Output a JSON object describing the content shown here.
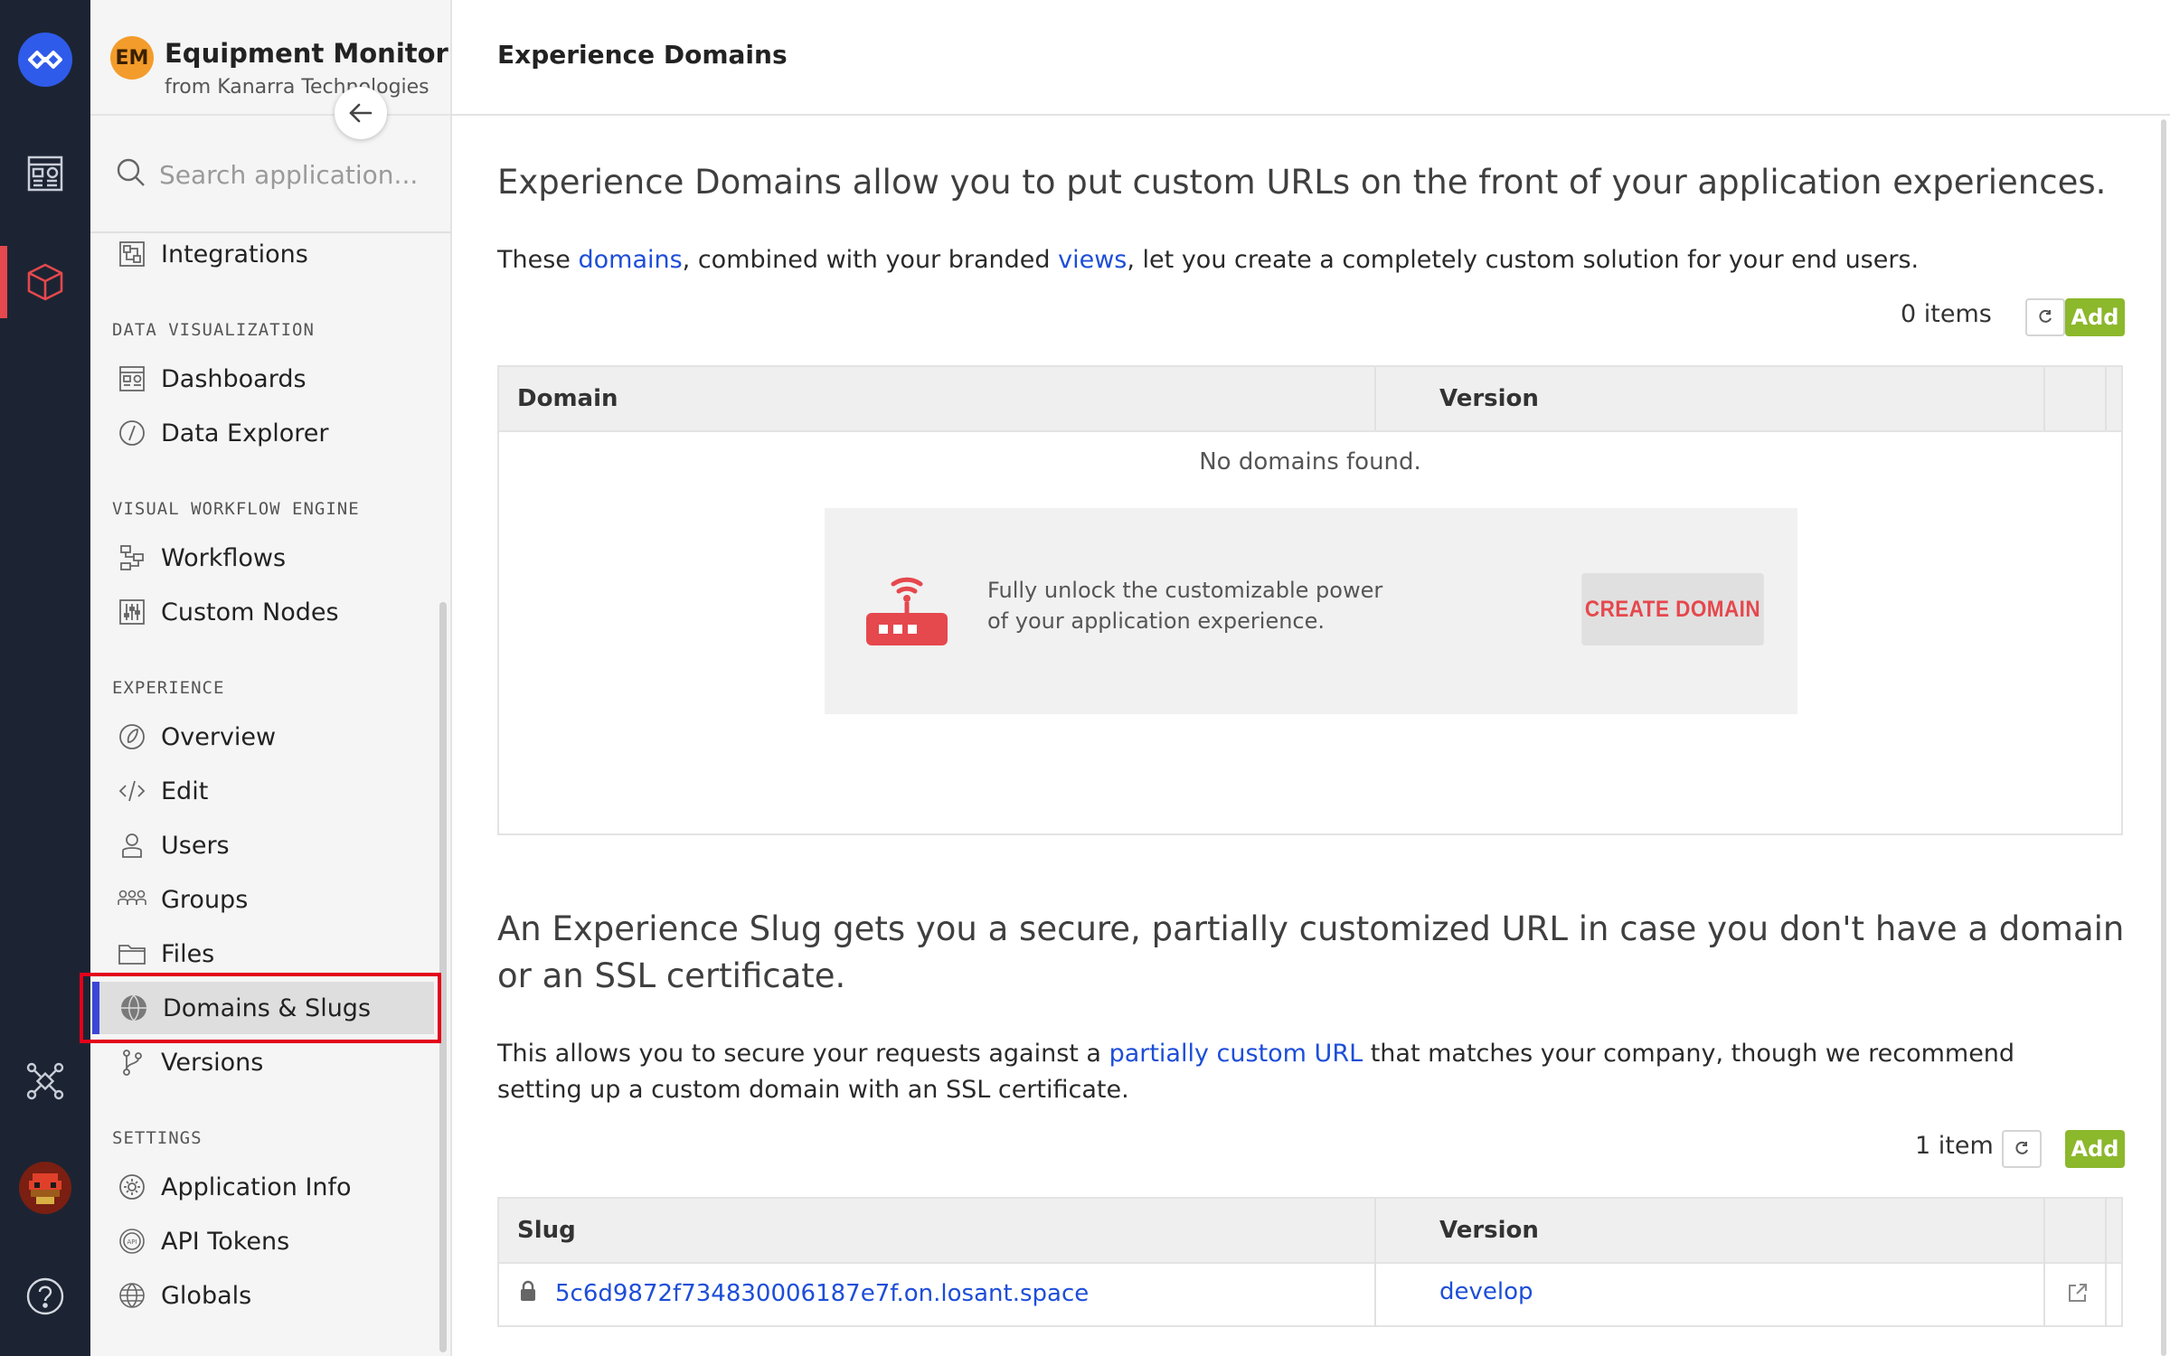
{
  "app": {
    "initials": "EM",
    "name": "Equipment Monitor",
    "org": "from Kanarra Technologies"
  },
  "search": {
    "placeholder": "Search application..."
  },
  "sidebar": {
    "integrations": "Integrations",
    "sections": {
      "data_viz": "DATA VISUALIZATION",
      "workflow": "VISUAL WORKFLOW ENGINE",
      "experience": "EXPERIENCE",
      "settings": "SETTINGS"
    },
    "items": {
      "dashboards": "Dashboards",
      "data_explorer": "Data Explorer",
      "workflows": "Workflows",
      "custom_nodes": "Custom Nodes",
      "overview": "Overview",
      "edit": "Edit",
      "users": "Users",
      "groups": "Groups",
      "files": "Files",
      "domains_slugs": "Domains & Slugs",
      "versions": "Versions",
      "application_info": "Application Info",
      "api_tokens": "API Tokens",
      "globals": "Globals"
    },
    "active_item": "Domains & Slugs"
  },
  "page": {
    "title": "Experience Domains"
  },
  "domains": {
    "lead": "Experience Domains allow you to put custom URLs on the front of your application experiences.",
    "para_prefix": "These ",
    "para_link1": "domains",
    "para_mid": ", combined with your branded ",
    "para_link2": "views",
    "para_suffix": ", let you create a completely custom solution for your end users.",
    "count": "0 items",
    "add_label": "Add",
    "columns": [
      "Domain",
      "Version"
    ],
    "empty_text": "No domains found.",
    "promo_text": "Fully unlock the customizable power of your application experience.",
    "create_label": "CREATE DOMAIN"
  },
  "slugs": {
    "lead": "An Experience Slug gets you a secure, partially customized URL in case you don't have a domain or an SSL certificate.",
    "para_prefix": "This allows you to secure your requests against a ",
    "para_link": "partially custom URL",
    "para_suffix": " that matches your company, though we recommend setting up a custom domain with an SSL certificate.",
    "count": "1 item",
    "add_label": "Add",
    "columns": [
      "Slug",
      "Version"
    ],
    "rows": [
      {
        "slug": "5c6d9872f734830006187e7f.on.losant.space",
        "version": "develop"
      }
    ]
  },
  "colors": {
    "rail_bg": "#1c2433",
    "accent_red": "#e5484d",
    "add_green": "#8cb82c",
    "link_blue": "#1d4ed8",
    "active_accent": "#3b46d6"
  },
  "icons": {
    "rail": [
      "losant-logo-icon",
      "dashboards-icon",
      "applications-cube-icon",
      "edge-devices-icon",
      "user-avatar-icon",
      "help-icon"
    ],
    "promo": "router-wifi-icon"
  }
}
